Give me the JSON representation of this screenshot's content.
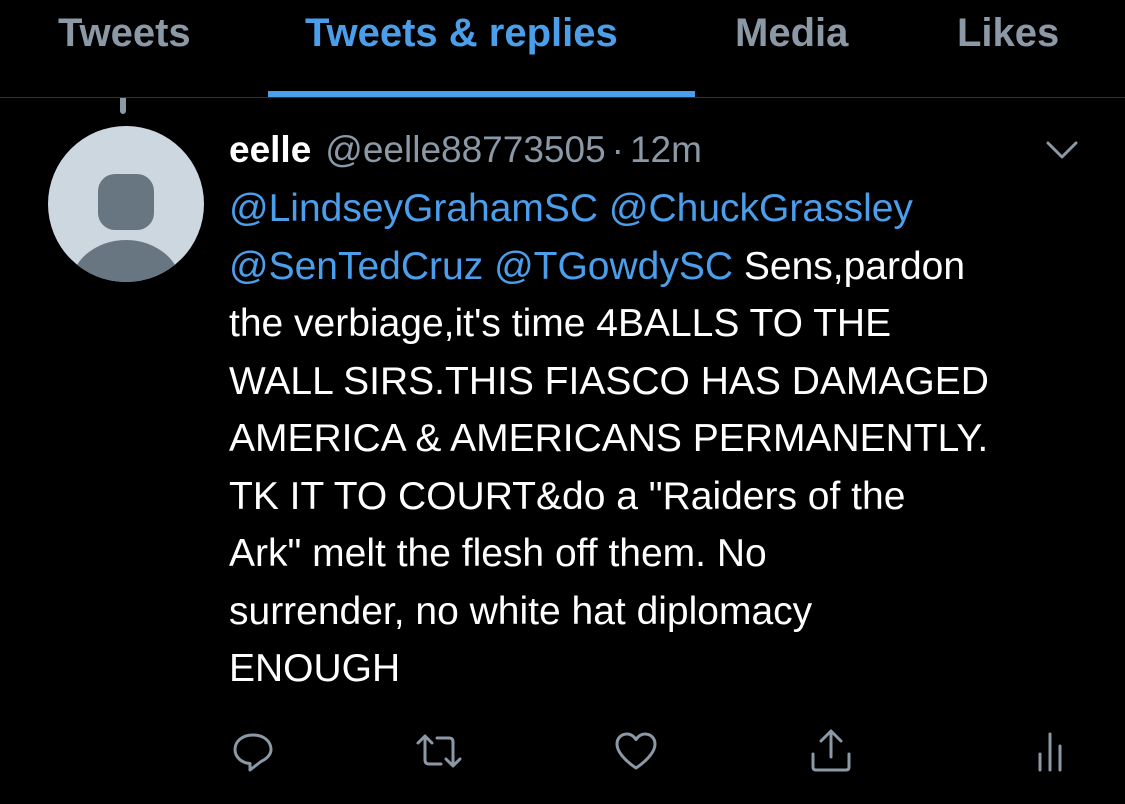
{
  "tabs": [
    {
      "label": "Tweets",
      "active": false
    },
    {
      "label": "Tweets & replies",
      "active": true
    },
    {
      "label": "Media",
      "active": false
    },
    {
      "label": "Likes",
      "active": false
    }
  ],
  "tweet": {
    "display_name": "eelle",
    "handle": "@eelle88773505",
    "separator": "·",
    "time": "12m",
    "lines": [
      [
        "@LindseyGrahamSC",
        "@ChuckGrassley"
      ],
      [
        "@SenTedCruz",
        "@TGowdySC",
        "Sens,pardon"
      ],
      "the verbiage,it's time 4BALLS TO THE",
      "WALL SIRS.THIS FIASCO HAS DAMAGED",
      "AMERICA & AMERICANS PERMANENTLY.",
      "TK IT TO COURT&do a \"Raiders of the",
      "Ark\" melt the flesh off them. No",
      "surrender, no white hat diplomacy",
      "ENOUGH"
    ],
    "actions": [
      "reply-icon",
      "retweet-icon",
      "like-icon",
      "share-icon",
      "analytics-icon"
    ]
  },
  "colors": {
    "background": "#000000",
    "accent": "#4a9eea",
    "muted": "#8b98a5",
    "text": "#ffffff",
    "divider": "#2f3336",
    "avatar_bg": "#cdd7e0",
    "avatar_fg": "#687682"
  }
}
